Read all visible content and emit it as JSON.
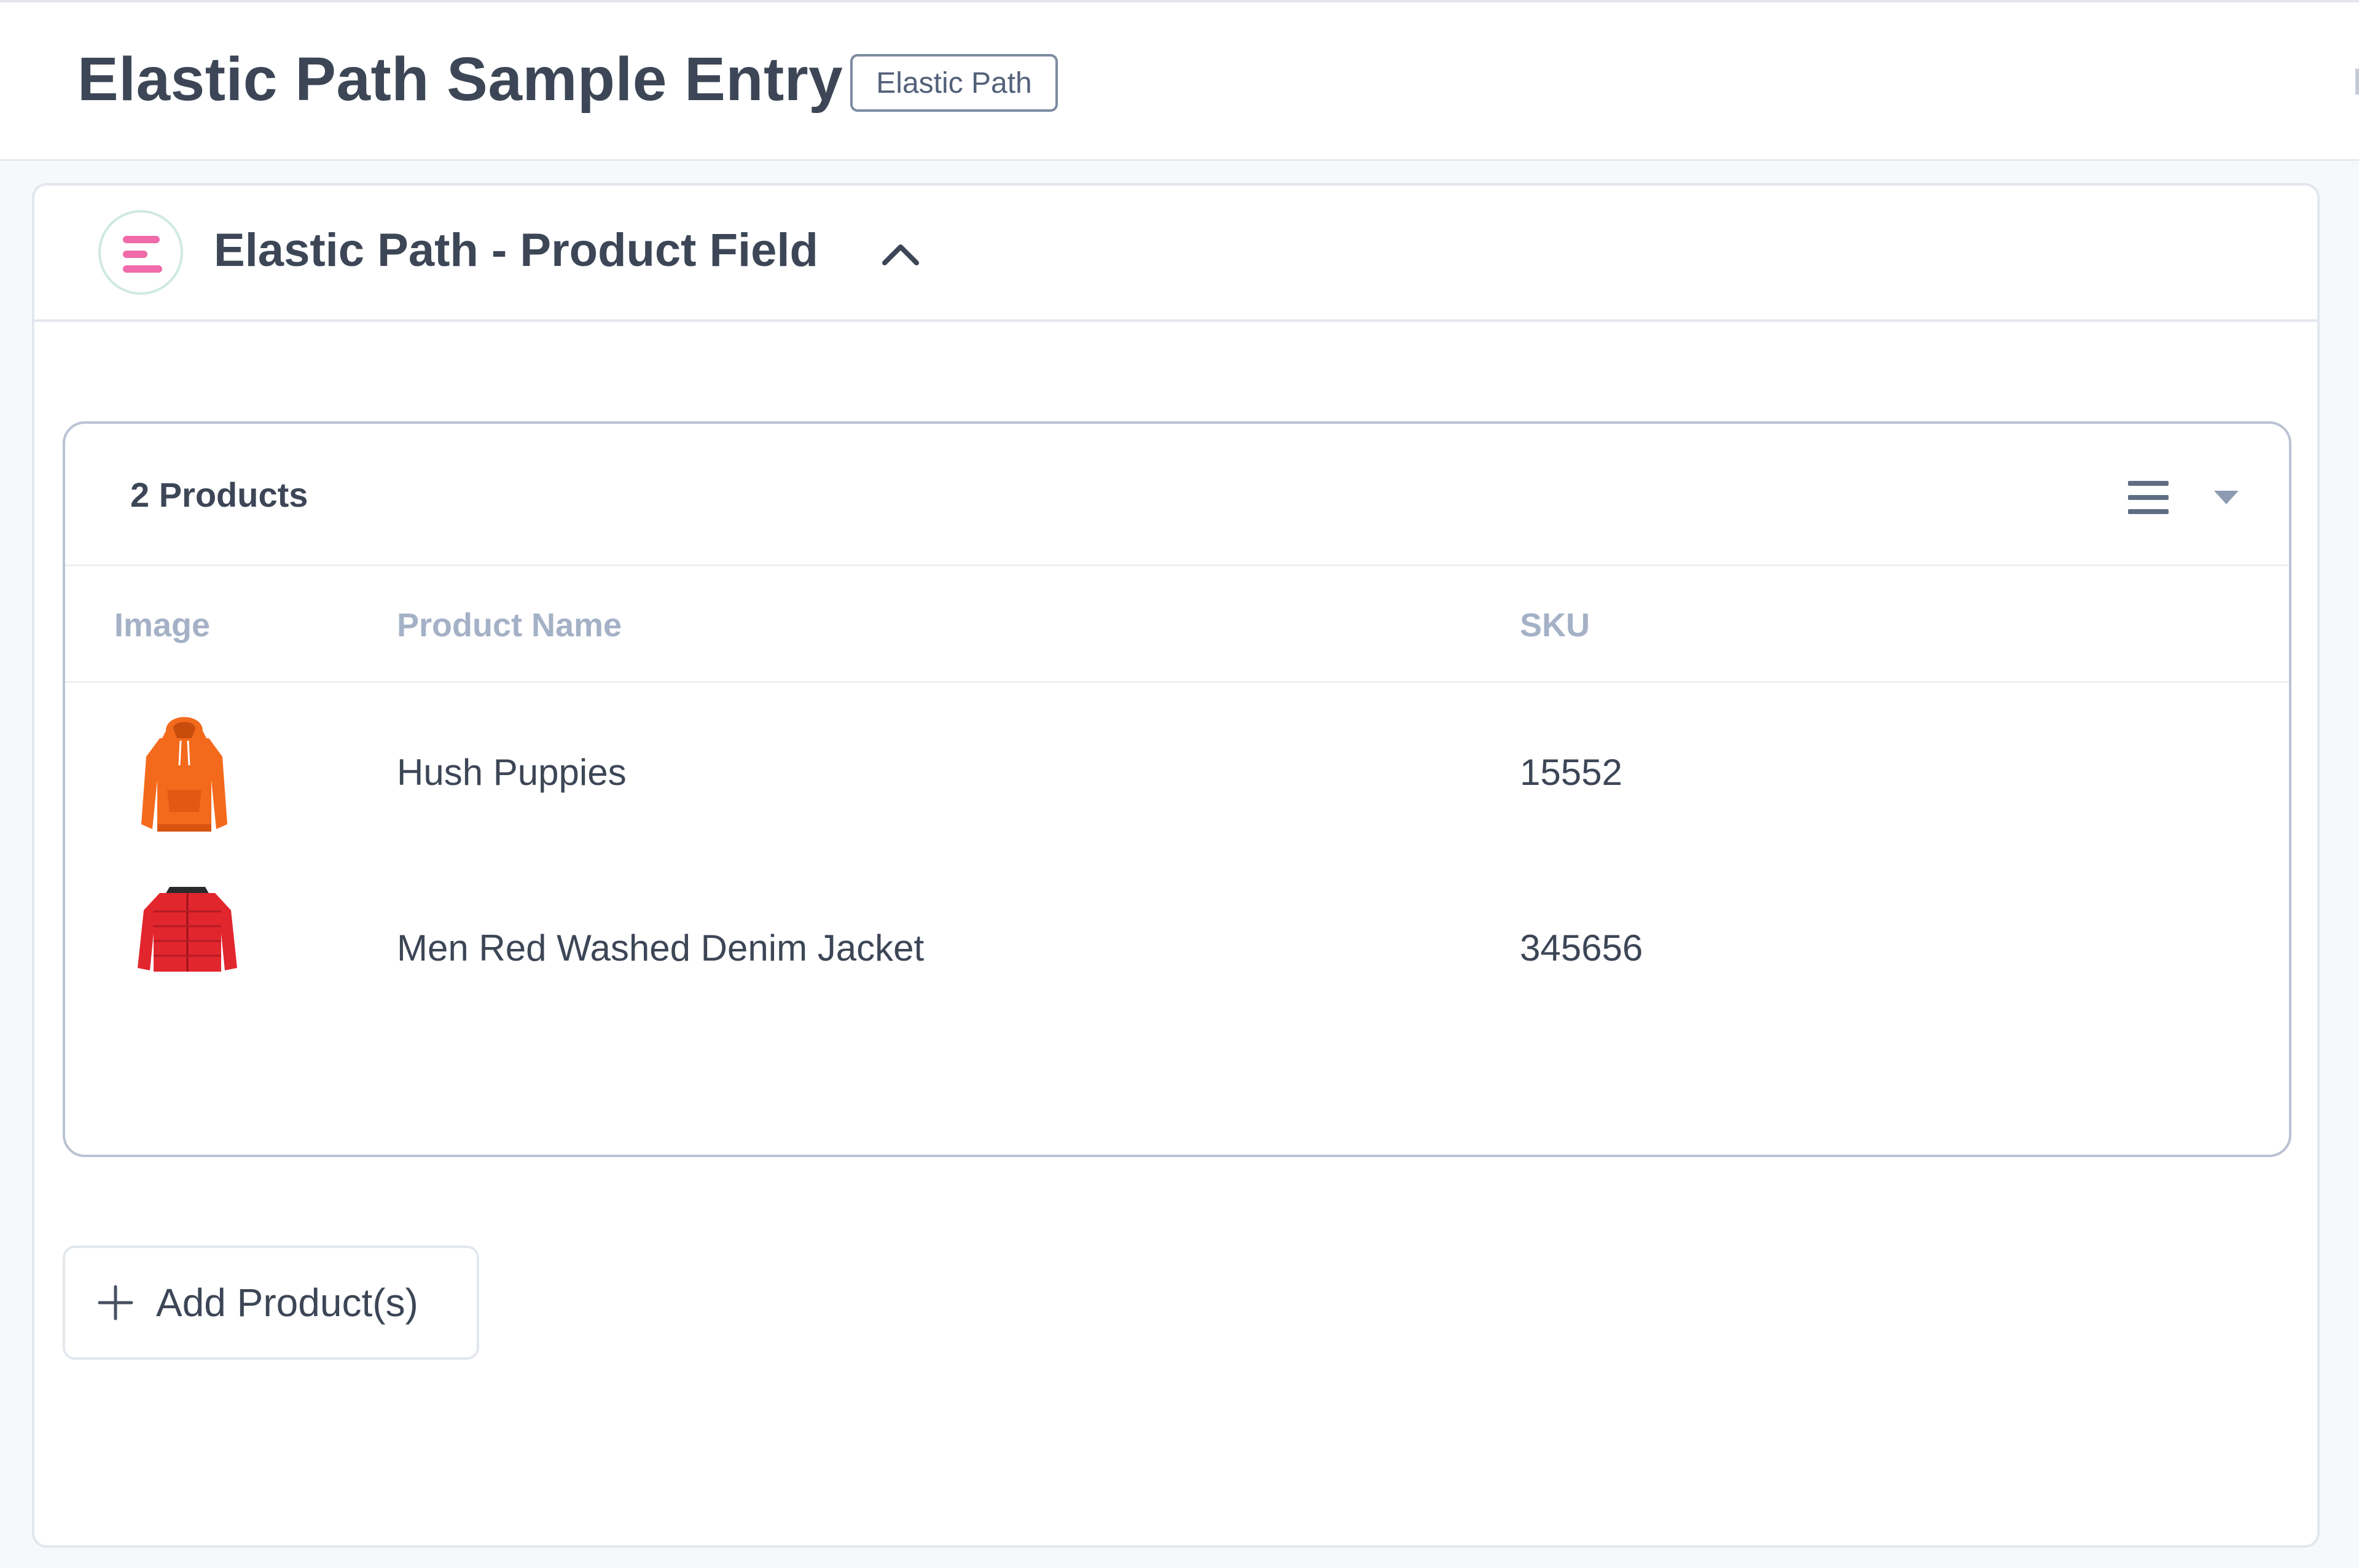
{
  "header": {
    "title": "Elastic Path Sample Entry",
    "badge": "Elastic Path"
  },
  "field": {
    "title": "Elastic Path - Product Field",
    "logo_icon": "elastic-path-logo",
    "toggle_icon": "chevron-up-icon"
  },
  "products_panel": {
    "count_label": "2 Products",
    "view_icon": "list-icon",
    "view_dropdown_icon": "caret-down-icon",
    "columns": {
      "image": "Image",
      "name": "Product Name",
      "sku": "SKU"
    },
    "rows": [
      {
        "name": "Hush Puppies",
        "sku": "15552",
        "image_icon": "orange-hoodie-icon"
      },
      {
        "name": "Men Red Washed Denim Jacket",
        "sku": "345656",
        "image_icon": "red-puffer-jacket-icon"
      }
    ]
  },
  "actions": {
    "add_label": "Add Product(s)",
    "add_icon": "plus-icon"
  },
  "colors": {
    "title_text": "#3c4656",
    "header_muted": "#a4b1c6",
    "logo_accent": "#ef6ba9",
    "panel_border": "#b9c3d3"
  }
}
